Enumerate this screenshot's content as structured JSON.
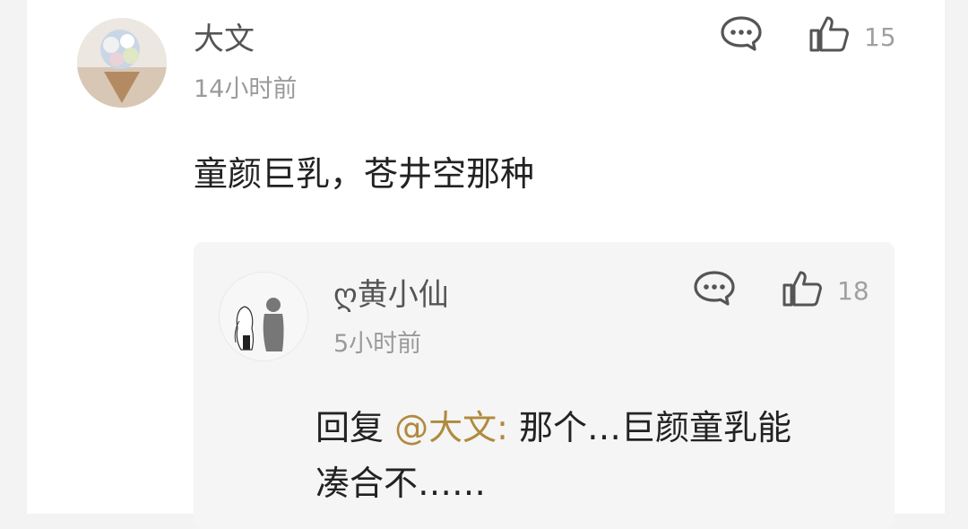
{
  "comment": {
    "author": "大文",
    "time": "14小时前",
    "text": "童颜巨乳，苍井空那种",
    "like_count": "15",
    "icons": {
      "reply": "comment-bubble-icon",
      "like": "thumbs-up-icon"
    }
  },
  "reply": {
    "author": "ღ黄小仙",
    "time": "5小时前",
    "prefix": "回复 ",
    "mention": "@大文:",
    "text_line1": " 那个…巨颜童乳能",
    "text_line2": "凑合不……",
    "like_count": "18",
    "icons": {
      "reply": "comment-bubble-icon",
      "like": "thumbs-up-icon"
    }
  },
  "colors": {
    "background": "#f3f3f3",
    "card": "#ffffff",
    "reply_box": "#f5f5f5",
    "mention": "#b08a3e",
    "muted": "#9a9a9a"
  }
}
